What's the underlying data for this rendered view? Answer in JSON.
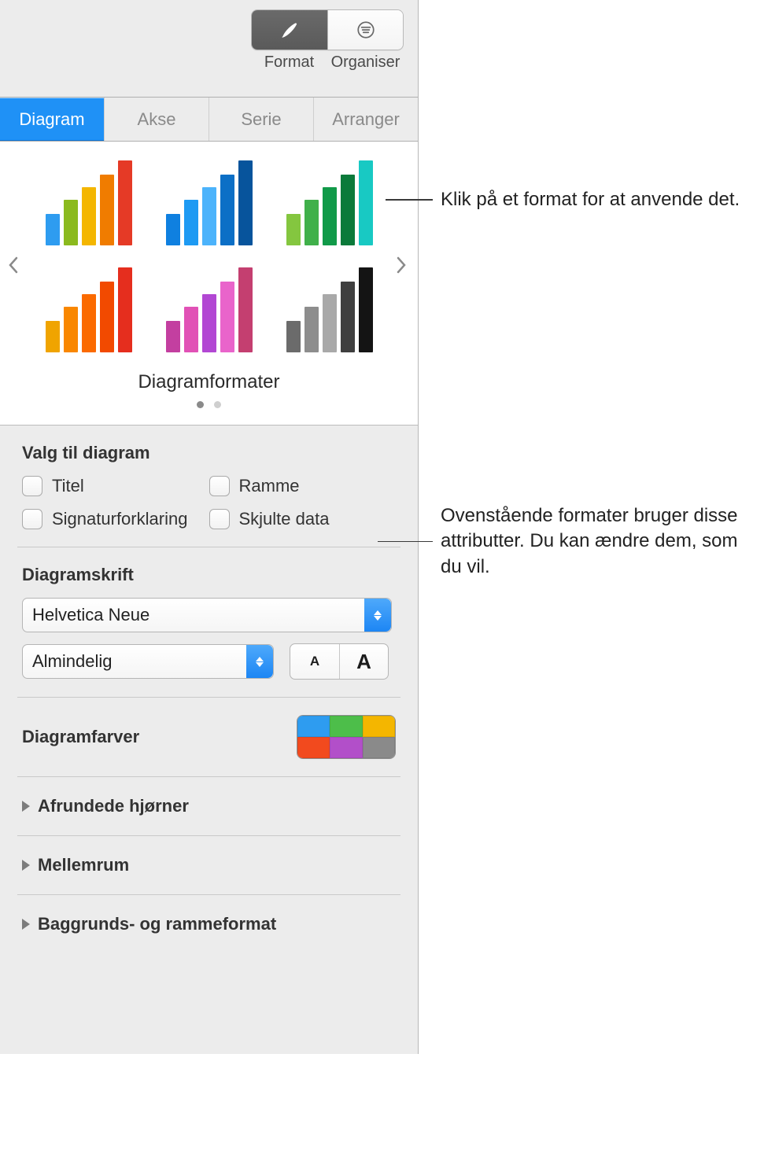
{
  "toolbar": {
    "format_label": "Format",
    "organize_label": "Organiser"
  },
  "tabs": [
    "Diagram",
    "Akse",
    "Serie",
    "Arranger"
  ],
  "styles": {
    "caption": "Diagramformater",
    "swatches": [
      {
        "heights": [
          40,
          58,
          74,
          90,
          108
        ],
        "colors": [
          "#2e9cf0",
          "#8bba1e",
          "#f4b600",
          "#f07c00",
          "#e53a26"
        ]
      },
      {
        "heights": [
          40,
          58,
          74,
          90,
          108
        ],
        "colors": [
          "#0f80e0",
          "#1d9af3",
          "#4cb3fb",
          "#0c6fc6",
          "#07549c"
        ]
      },
      {
        "heights": [
          40,
          58,
          74,
          90,
          108
        ],
        "colors": [
          "#84c63f",
          "#40b04a",
          "#119a49",
          "#0b7a3a",
          "#18c9c3"
        ]
      },
      {
        "heights": [
          40,
          58,
          74,
          90,
          108
        ],
        "colors": [
          "#f0a400",
          "#f98700",
          "#fb6a00",
          "#f24a00",
          "#e52e1e"
        ]
      },
      {
        "heights": [
          40,
          58,
          74,
          90,
          108
        ],
        "colors": [
          "#c33fa0",
          "#e151b6",
          "#b247d3",
          "#e964cb",
          "#c43f70"
        ]
      },
      {
        "heights": [
          40,
          58,
          74,
          90,
          108
        ],
        "colors": [
          "#6b6b6b",
          "#8d8d8d",
          "#a9a9a9",
          "#3f3f3f",
          "#141414"
        ]
      }
    ]
  },
  "options": {
    "heading": "Valg til diagram",
    "title": "Titel",
    "legend": "Signaturforklaring",
    "frame": "Ramme",
    "hidden": "Skjulte data"
  },
  "font": {
    "heading": "Diagramskrift",
    "family": "Helvetica Neue",
    "weight": "Almindelig",
    "size_small": "A",
    "size_large": "A"
  },
  "colors": {
    "heading": "Diagramfarver",
    "cells": [
      "#2e9cf0",
      "#4dbe4a",
      "#f4b600",
      "#f24a1e",
      "#b24fc9",
      "#8a8a8a"
    ]
  },
  "disclosures": {
    "rounded": "Afrundede hjørner",
    "gaps": "Mellemrum",
    "bgframe": "Baggrunds- og rammeformat"
  },
  "callouts": {
    "style": "Klik på et format for at anvende det.",
    "attrs": "Ovenstående formater bruger disse attributter. Du kan ændre dem, som du vil."
  }
}
